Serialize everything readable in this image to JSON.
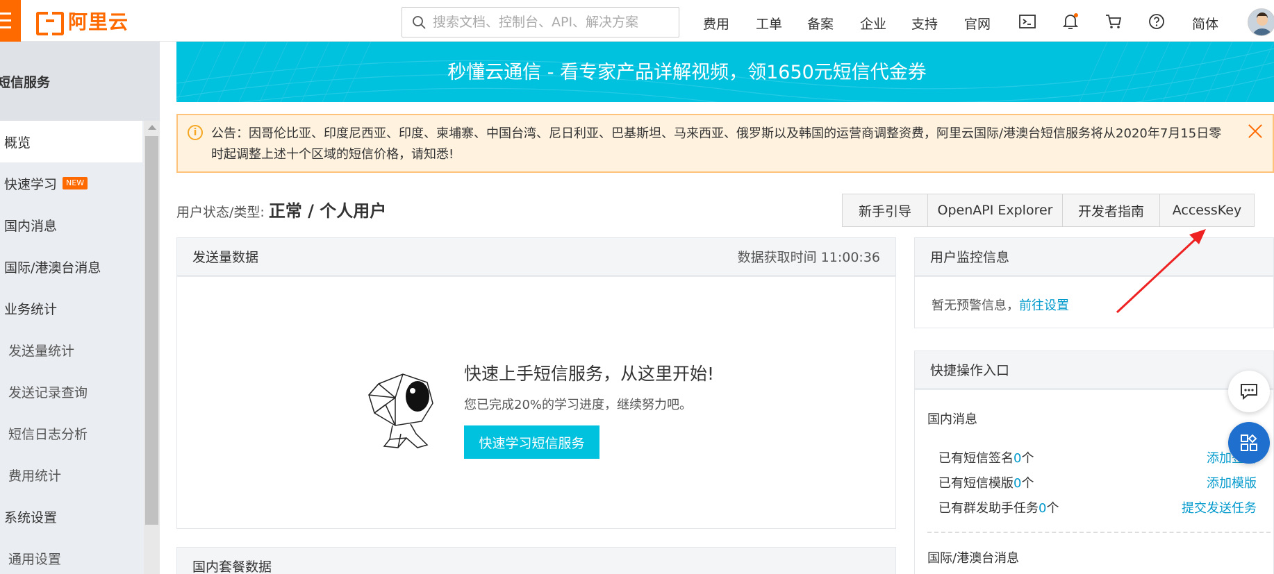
{
  "header": {
    "brand": "阿里云",
    "search_placeholder": "搜索文档、控制台、API、解决方案",
    "nav": [
      "费用",
      "工单",
      "备案",
      "企业",
      "支持",
      "官网"
    ],
    "language": "简体",
    "icons": [
      "terminal-icon",
      "bell-icon",
      "cart-icon",
      "help-icon"
    ],
    "accent": "#ff6a00"
  },
  "sidebar": {
    "title": "短信服务",
    "items": [
      {
        "label": "概览"
      },
      {
        "label": "快速学习",
        "badge": "NEW"
      },
      {
        "label": "国内消息"
      },
      {
        "label": "国际/港澳台消息"
      },
      {
        "label": "业务统计"
      },
      {
        "label": "发送量统计"
      },
      {
        "label": "发送记录查询"
      },
      {
        "label": "短信日志分析"
      },
      {
        "label": "费用统计"
      },
      {
        "label": "系统设置"
      },
      {
        "label": "通用设置"
      }
    ]
  },
  "banner": {
    "text": "秒懂云通信 - 看专家产品详解视频，领1650元短信代金券",
    "color": "#00c1de"
  },
  "notice": {
    "text": "公告：因哥伦比亚、印度尼西亚、印度、柬埔寨、中国台湾、尼日利亚、巴基斯坦、马来西亚、俄罗斯以及韩国的运营商调整资费，阿里云国际/港澳台短信服务将从2020年7月15日零时起调整上述十个区域的短信价格，请知悉!"
  },
  "user_status": {
    "label": "用户状态/类型:",
    "value": "正常 / 个人用户"
  },
  "quick_buttons": [
    "新手引导",
    "OpenAPI Explorer",
    "开发者指南",
    "AccessKey"
  ],
  "send_panel": {
    "title": "发送量数据",
    "fetch_time": "数据获取时间 11:00:36",
    "onboard_title": "快速上手短信服务，从这里开始!",
    "onboard_sub": "您已完成20%的学习进度，继续努力吧。",
    "onboard_button": "快速学习短信服务"
  },
  "package_panel": {
    "title": "国内套餐数据"
  },
  "monitor_panel": {
    "title": "用户监控信息",
    "text": "暂无预警信息，",
    "link": "前往设置"
  },
  "quick_panel": {
    "title": "快捷操作入口",
    "domestic_title": "国内消息",
    "rows": [
      {
        "prefix": "已有短信签名",
        "count": "0",
        "suffix": "个",
        "action": "添加签名"
      },
      {
        "prefix": "已有短信模版",
        "count": "0",
        "suffix": "个",
        "action": "添加模版"
      },
      {
        "prefix": "已有群发助手任务",
        "count": "0",
        "suffix": "个",
        "action": "提交发送任务"
      }
    ],
    "intl_title": "国际/港澳台消息"
  }
}
